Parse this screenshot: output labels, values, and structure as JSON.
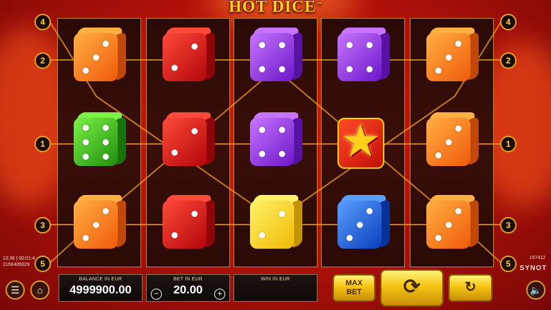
{
  "game": {
    "title": "HOT DICE",
    "trademark": "™",
    "brand": "SYNOT"
  },
  "status": {
    "time": "13:36 | 00:01:4",
    "session_id": "2156405029",
    "machine_id": "157412"
  },
  "paylines": {
    "left": [
      "4",
      "2",
      "1",
      "3",
      "5"
    ],
    "right": [
      "4",
      "2",
      "1",
      "3",
      "5"
    ]
  },
  "reels": [
    [
      {
        "color": "orange",
        "pips": 3
      },
      {
        "color": "green",
        "pips": 6
      },
      {
        "color": "orange",
        "pips": 3
      }
    ],
    [
      {
        "color": "red",
        "pips": 2
      },
      {
        "color": "red",
        "pips": 2
      },
      {
        "color": "red",
        "pips": 2
      }
    ],
    [
      {
        "color": "purple",
        "pips": 4
      },
      {
        "color": "purple",
        "pips": 4
      },
      {
        "color": "yellow",
        "pips": 2
      }
    ],
    [
      {
        "color": "purple",
        "pips": 4
      },
      {
        "color": "star",
        "pips": 0
      },
      {
        "color": "blue",
        "pips": 3
      }
    ],
    [
      {
        "color": "orange",
        "pips": 3
      },
      {
        "color": "orange",
        "pips": 3
      },
      {
        "color": "orange",
        "pips": 3
      }
    ]
  ],
  "colors": {
    "orange": [
      "#ffb043",
      "#f05a0a"
    ],
    "red": [
      "#ff4a3a",
      "#b3060a"
    ],
    "purple": [
      "#c775ff",
      "#6d16c9"
    ],
    "green": [
      "#7bf045",
      "#1f8f0c"
    ],
    "yellow": [
      "#fff36a",
      "#f2b905"
    ],
    "blue": [
      "#5aa0ff",
      "#0b3fbe"
    ],
    "accent_gold": "#e4a21f"
  },
  "bottom_bar": {
    "balance_label": "BALANCE IN EUR",
    "balance_value": "4999900.00",
    "bet_label": "BET IN EUR",
    "bet_value": "20.00",
    "bet_minus": "−",
    "bet_plus": "+",
    "win_label": "WIN IN EUR",
    "win_value": "",
    "max_bet_line1": "MAX",
    "max_bet_line2": "BET",
    "spin_icon": "refresh-icon",
    "autoplay_icon": "autoplay-icon"
  },
  "icons": {
    "menu": "menu-icon",
    "home": "home-icon",
    "sound": "speaker-icon"
  }
}
